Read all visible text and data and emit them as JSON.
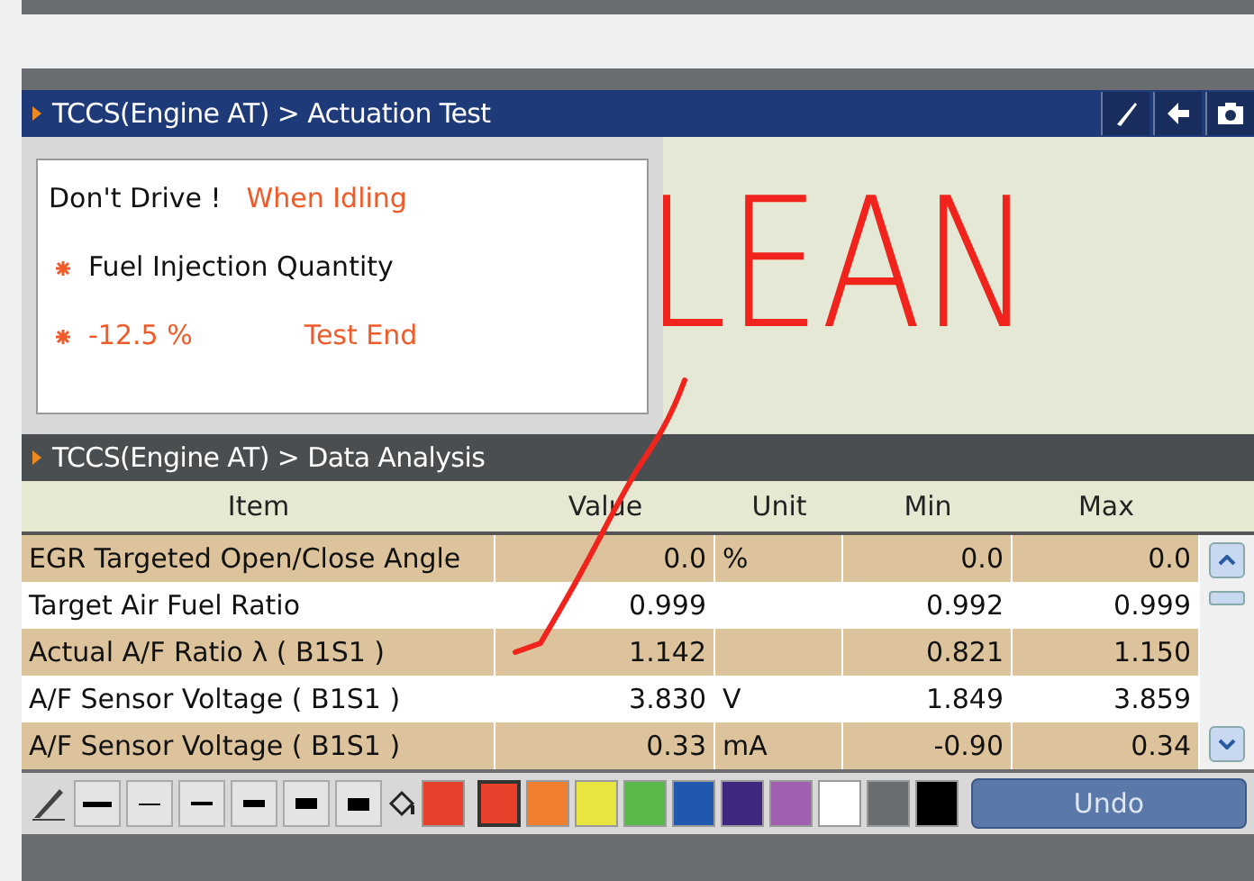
{
  "actuation": {
    "title": "TCCS(Engine AT) > Actuation Test",
    "warning": "Don't Drive !",
    "condition": "When Idling",
    "item": "Fuel Injection Quantity",
    "reading": "-12.5 %",
    "status": "Test End"
  },
  "annotation": {
    "text": "LEAN"
  },
  "analysis": {
    "title": "TCCS(Engine AT) > Data Analysis",
    "columns": [
      "Item",
      "Value",
      "Unit",
      "Min",
      "Max"
    ],
    "rows": [
      {
        "cells": [
          "EGR Targeted Open/Close Angle",
          "0.0",
          "%",
          "0.0",
          "0.0"
        ]
      },
      {
        "cells": [
          "Target Air Fuel Ratio",
          "0.999",
          "",
          "0.992",
          "0.999"
        ]
      },
      {
        "cells": [
          "Actual A/F Ratio λ ( B1S1 )",
          "1.142",
          "",
          "0.821",
          "1.150"
        ]
      },
      {
        "cells": [
          "A/F Sensor Voltage ( B1S1 )",
          "3.830",
          "V",
          "1.849",
          "3.859"
        ]
      },
      {
        "cells": [
          "A/F Sensor Voltage ( B1S1 )",
          "0.33",
          "mA",
          "-0.90",
          "0.34"
        ]
      }
    ]
  },
  "toolbar": {
    "line_widths": [
      {
        "selected": false
      },
      {
        "selected": false
      },
      {
        "selected": false
      },
      {
        "selected": false
      },
      {
        "selected": false
      }
    ],
    "colors": [
      {
        "color": "#e8402a",
        "selected": true
      },
      {
        "color": "#f08030",
        "selected": false
      },
      {
        "color": "#e8e440",
        "selected": false
      },
      {
        "color": "#58b848",
        "selected": false
      },
      {
        "color": "#2058b0",
        "selected": false
      },
      {
        "color": "#402880",
        "selected": false
      },
      {
        "color": "#a060b0",
        "selected": false
      },
      {
        "color": "#ffffff",
        "selected": false
      },
      {
        "color": "#6a6e70",
        "selected": false
      },
      {
        "color": "#000000",
        "selected": false
      }
    ],
    "undo": "Undo"
  }
}
